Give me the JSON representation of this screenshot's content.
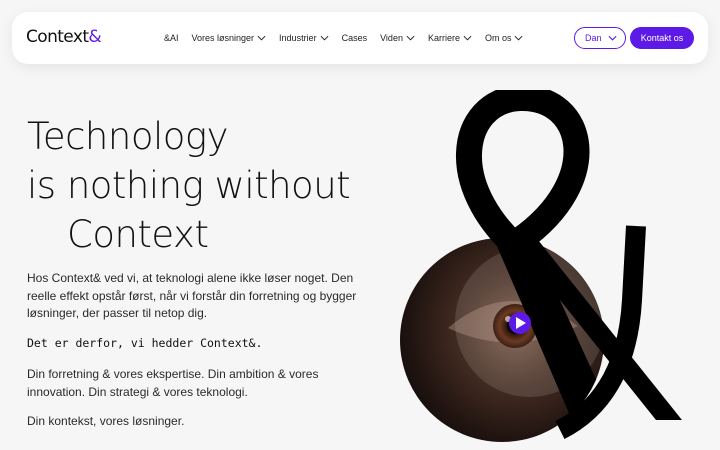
{
  "header": {
    "logo_text": "Context",
    "logo_amp": "&",
    "nav": [
      {
        "label": "&AI",
        "has_dropdown": false
      },
      {
        "label": "Vores løsninger",
        "has_dropdown": true
      },
      {
        "label": "Industrier",
        "has_dropdown": true
      },
      {
        "label": "Cases",
        "has_dropdown": false
      },
      {
        "label": "Viden",
        "has_dropdown": true
      },
      {
        "label": "Karriere",
        "has_dropdown": true
      },
      {
        "label": "Om os",
        "has_dropdown": true
      }
    ],
    "language_label": "Dan",
    "contact_label": "Kontakt os"
  },
  "hero": {
    "headline_line1": "Technology",
    "headline_line2": "is nothing without",
    "headline_line3": "Context",
    "paragraph1": "Hos Context& ved vi, at teknologi alene ikke løser noget. Den reelle effekt opstår først, når vi forstår din forretning og bygger løsninger, der passer til netop dig.",
    "tagline": "Det er derfor, vi hedder Context&.",
    "paragraph2": "Din forretning & vores ekspertise. Din ambition & vores innovation. Din strategi & vores teknologi.",
    "paragraph3": "Din kontekst, vores løsninger."
  },
  "icons": {
    "play": "play-icon",
    "chevron": "chevron-down-icon"
  },
  "colors": {
    "brand": "#5d1ae6",
    "background": "#f6f6f6",
    "text": "#141414"
  }
}
